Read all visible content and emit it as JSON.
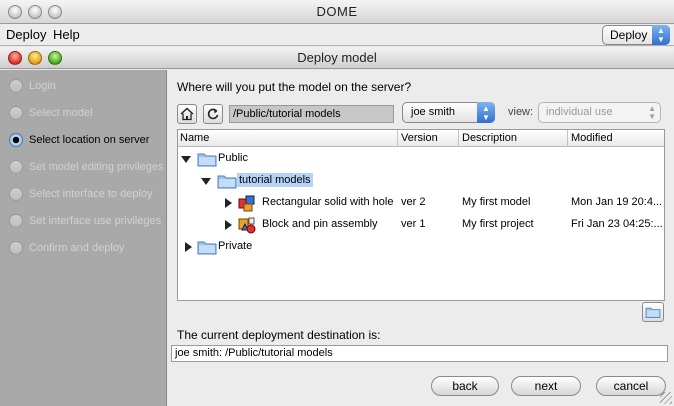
{
  "app": {
    "window_title": "DOME",
    "menu": [
      "Deploy",
      "Help"
    ],
    "mode_select": "Deploy"
  },
  "dialog": {
    "title": "Deploy model",
    "steps": [
      {
        "label": "Login",
        "active": false
      },
      {
        "label": "Select model",
        "active": false
      },
      {
        "label": "Select location on server",
        "active": true
      },
      {
        "label": "Set model editing privileges",
        "active": false
      },
      {
        "label": "Select interface to deploy",
        "active": false
      },
      {
        "label": "Set interface use privileges",
        "active": false
      },
      {
        "label": "Confirm and deploy",
        "active": false
      }
    ],
    "question": "Where will you put the model on the server?",
    "path": "/Public/tutorial models",
    "user_select": "joe smith",
    "view_label": "view:",
    "view_select": "individual use",
    "tree": {
      "columns": [
        "Name",
        "Version",
        "Description",
        "Modified"
      ],
      "rows": [
        {
          "name": "Public",
          "version": "",
          "description": "",
          "modified": ""
        },
        {
          "name": "tutorial models",
          "version": "",
          "description": "",
          "modified": ""
        },
        {
          "name": "Rectangular solid with hole",
          "version": "ver 2",
          "description": "My first model",
          "modified": "Mon Jan 19 20:4..."
        },
        {
          "name": "Block and pin assembly",
          "version": "ver 1",
          "description": "My first project",
          "modified": "Fri Jan 23 04:25:..."
        },
        {
          "name": "Private",
          "version": "",
          "description": "",
          "modified": ""
        }
      ]
    },
    "destination_label": "The current deployment destination is:",
    "destination_value": "joe smith: /Public/tutorial models",
    "buttons": {
      "back": "back",
      "next": "next",
      "cancel": "cancel"
    }
  },
  "colors": {
    "selection": "#b5d3f5",
    "steps_panel": "#a9a9a9",
    "accent_blue": "#2f6fd0"
  }
}
